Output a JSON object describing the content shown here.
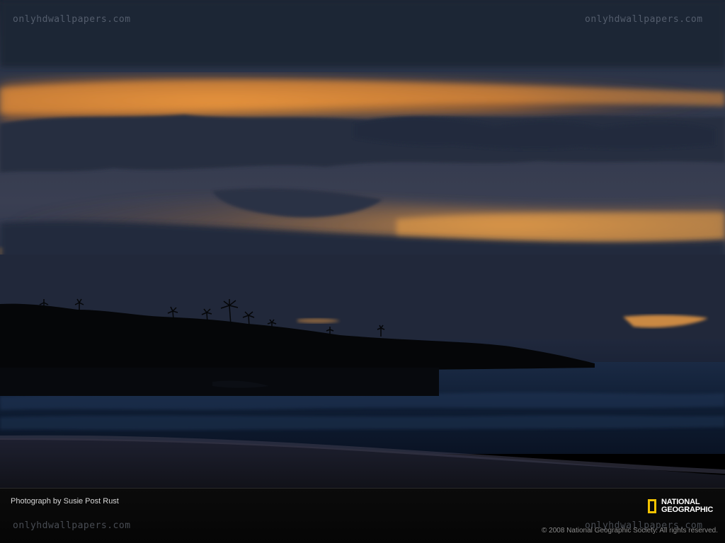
{
  "image": {
    "subject": "sunset over ocean beach with silhouetted palm-covered headland",
    "colors": {
      "sky_dark": "#1c2536",
      "sky_glow": "#e58a2a",
      "sea": "#0d1a2e",
      "land": "#050608"
    }
  },
  "watermarks": {
    "top_left": "onlyhdwallpapers.com",
    "top_right": "onlyhdwallpapers.com",
    "bottom_left": "onlyhdwallpapers.com",
    "bottom_right": "onlyhdwallpapers.com"
  },
  "footer": {
    "credit": "Photograph by Susie Post Rust",
    "copyright": "© 2008 National Geographic Society. All rights reserved.",
    "logo": {
      "line1": "NATIONAL",
      "line2": "GEOGRAPHIC",
      "frame_color": "#f2c200"
    }
  }
}
